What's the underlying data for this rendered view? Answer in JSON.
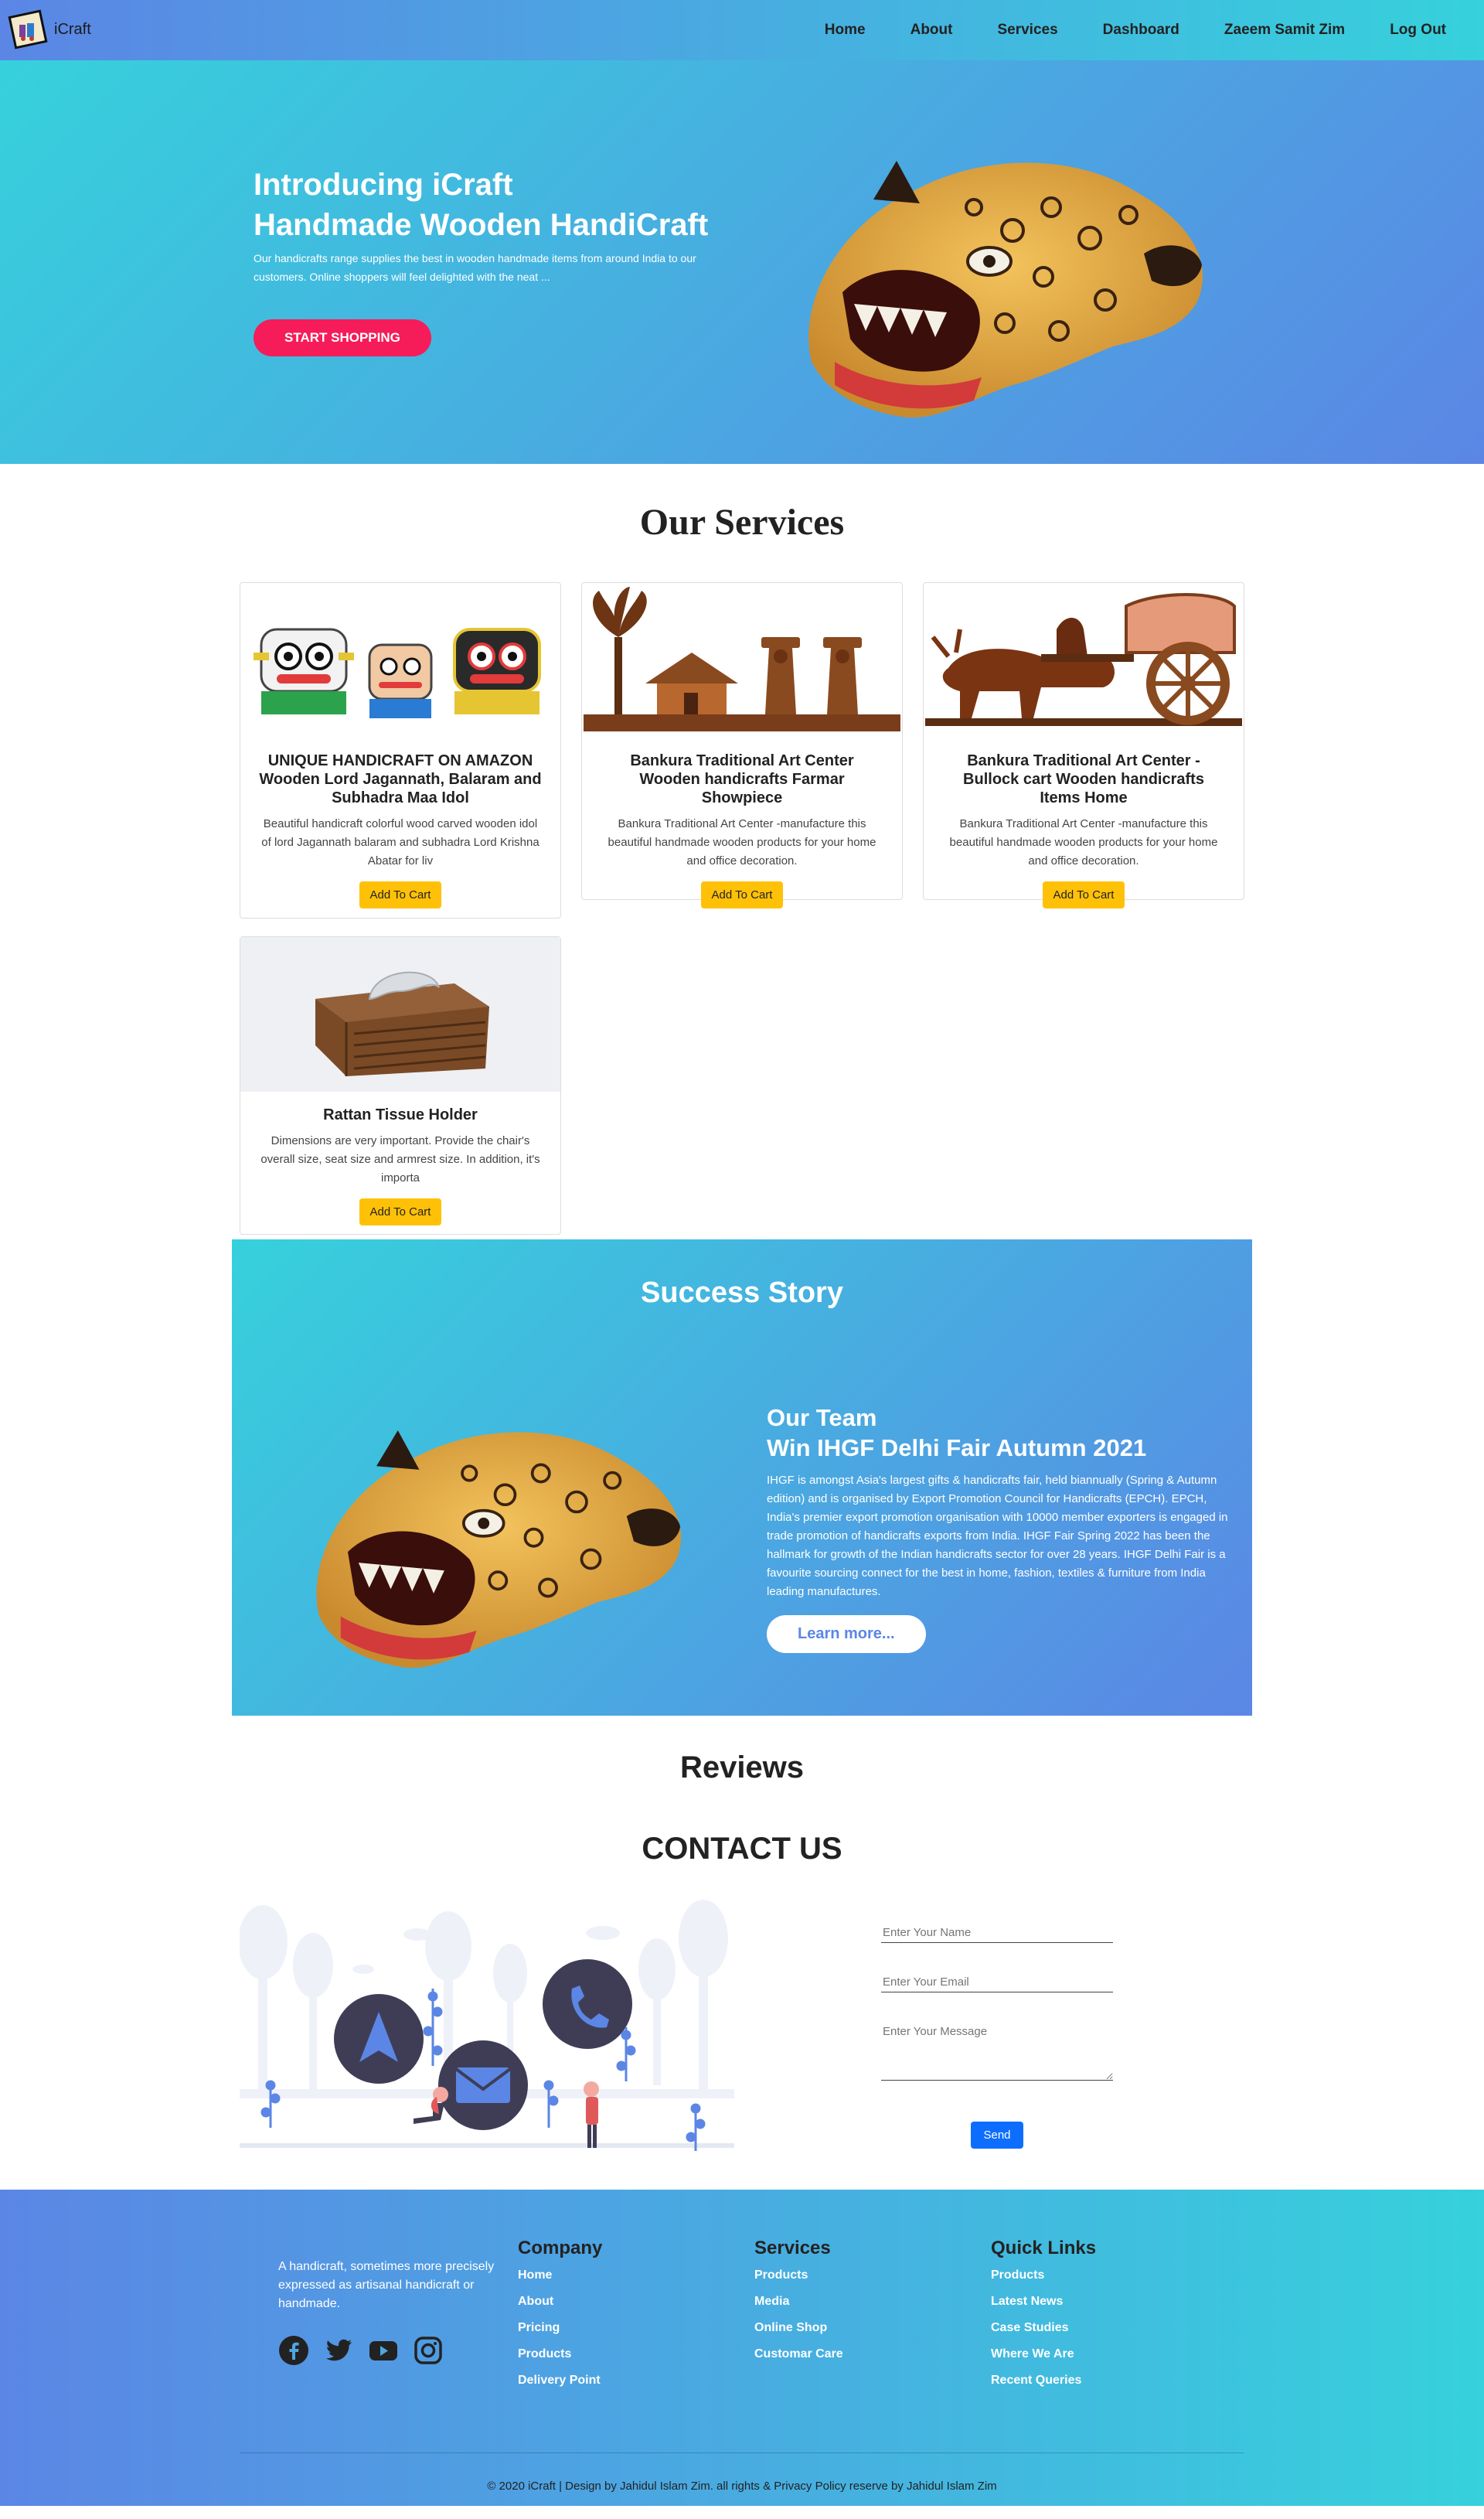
{
  "brand": {
    "name": "iCraft",
    "logo_icon": "framed-chariot-logo-icon"
  },
  "nav": {
    "items": [
      "Home",
      "About",
      "Services",
      "Dashboard",
      "Zaeem Samit Zim",
      "Log Out"
    ]
  },
  "hero": {
    "title_line1": "Introducing iCraft",
    "title_line2": "Handmade Wooden HandiCraft",
    "description": "Our handicrafts range supplies the best in wooden handmade items from around India to our customers. Online shoppers will feel delighted with the neat ...",
    "cta_label": "START SHOPPING",
    "image_icon": "wooden-tiger-mask-image"
  },
  "services": {
    "title": "Our Services",
    "cards": [
      {
        "title": "UNIQUE HANDICRAFT ON AMAZON Wooden Lord Jagannath, Balaram and Subhadra Maa Idol",
        "description": "Beautiful handicraft colorful wood carved wooden idol of lord Jagannath balaram and subhadra Lord Krishna Abatar for liv",
        "button": "Add To Cart",
        "image_icon": "jagannath-idols-image"
      },
      {
        "title": "Bankura Traditional Art Center Wooden handicrafts Farmar Showpiece",
        "description": "Bankura Traditional Art Center -manufacture this beautiful handmade wooden products for your home and office decoration.",
        "button": "Add To Cart",
        "image_icon": "farmer-showpiece-image"
      },
      {
        "title": "Bankura Traditional Art Center - Bullock cart Wooden handicrafts Items Home",
        "description": "Bankura Traditional Art Center -manufacture this beautiful handmade wooden products for your home and office decoration.",
        "button": "Add To Cart",
        "image_icon": "bullock-cart-image"
      },
      {
        "title": "Rattan Tissue Holder",
        "description": "Dimensions are very important. Provide the chair's overall size, seat size and armrest size. In addition, it's importa",
        "button": "Add To Cart",
        "image_icon": "rattan-tissue-box-image"
      }
    ]
  },
  "success": {
    "title": "Success Story",
    "heading1": "Our Team",
    "heading2": "Win IHGF Delhi Fair Autumn 2021",
    "body": "IHGF is amongst Asia's largest gifts & handicrafts fair, held biannually (Spring & Autumn edition) and is organised by Export Promotion Council for Handicrafts (EPCH). EPCH, India's premier export promotion organisation with 10000 member exporters is engaged in trade promotion of handicrafts exports from India. IHGF Fair Spring 2022 has been the hallmark for growth of the Indian handicrafts sector for over 28 years. IHGF Delhi Fair is a favourite sourcing connect for the best in home, fashion, textiles & furniture from India leading manufactures.",
    "button": "Learn more...",
    "image_icon": "wooden-tiger-mask-image"
  },
  "reviews": {
    "title": "Reviews"
  },
  "contact": {
    "title": "CONTACT US",
    "name_placeholder": "Enter Your Name",
    "email_placeholder": "Enter Your Email",
    "message_placeholder": "Enter Your Message",
    "send_label": "Send",
    "illustration_icon": "contact-illustration"
  },
  "footer": {
    "about": "A handicraft, sometimes more precisely expressed as artisanal handicraft or handmade.",
    "socials": [
      "facebook-icon",
      "twitter-icon",
      "youtube-icon",
      "instagram-icon"
    ],
    "columns": [
      {
        "title": "Company",
        "links": [
          "Home",
          "About",
          "Pricing",
          "Products",
          "Delivery Point"
        ]
      },
      {
        "title": "Services",
        "links": [
          "Products",
          "Media",
          "Online Shop",
          "Customar Care"
        ]
      },
      {
        "title": "Quick Links",
        "links": [
          "Products",
          "Latest News",
          "Case Studies",
          "Where We Are",
          "Recent Queries"
        ]
      }
    ],
    "copyright": "© 2020 iCraft | Design by Jahidul Islam Zim. all rights & Privacy Policy reserve by Jahidul Islam Zim"
  },
  "colors": {
    "gradient_start": "#36d1dc",
    "gradient_end": "#5b86e5",
    "cta_pink": "#f51c59",
    "cart_yellow": "#ffc107",
    "send_blue": "#0d6efd"
  }
}
